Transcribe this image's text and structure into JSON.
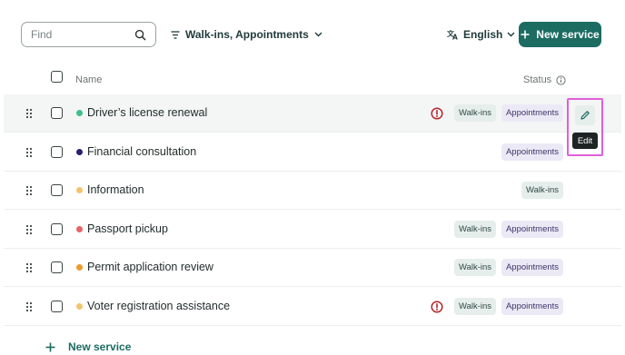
{
  "toolbar": {
    "search_placeholder": "Find",
    "filter_label": "Walk-ins, Appointments",
    "language_label": "English",
    "new_service_label": "New service"
  },
  "table": {
    "columns": {
      "name": "Name",
      "status": "Status"
    },
    "rows": [
      {
        "name": "Driver’s license renewal",
        "dot_color": "#3fc08a",
        "warning": true,
        "badges": [
          "Walk-ins",
          "Appointments"
        ]
      },
      {
        "name": "Financial consultation",
        "dot_color": "#2b1f6e",
        "warning": false,
        "badges": [
          "Appointments"
        ]
      },
      {
        "name": "Information",
        "dot_color": "#f3c46c",
        "warning": false,
        "badges": [
          "Walk-ins"
        ]
      },
      {
        "name": "Passport pickup",
        "dot_color": "#e8646a",
        "warning": false,
        "badges": [
          "Walk-ins",
          "Appointments"
        ]
      },
      {
        "name": "Permit application review",
        "dot_color": "#ef9a2e",
        "warning": false,
        "badges": [
          "Walk-ins",
          "Appointments"
        ]
      },
      {
        "name": "Voter registration assistance",
        "dot_color": "#f3c46c",
        "warning": true,
        "badges": [
          "Walk-ins",
          "Appointments"
        ]
      }
    ]
  },
  "edit_tooltip": "Edit",
  "footer": {
    "add_label": "New service"
  },
  "colors": {
    "accent": "#1c6c62",
    "warning": "#b3262d",
    "highlight": "#e05fd8"
  }
}
